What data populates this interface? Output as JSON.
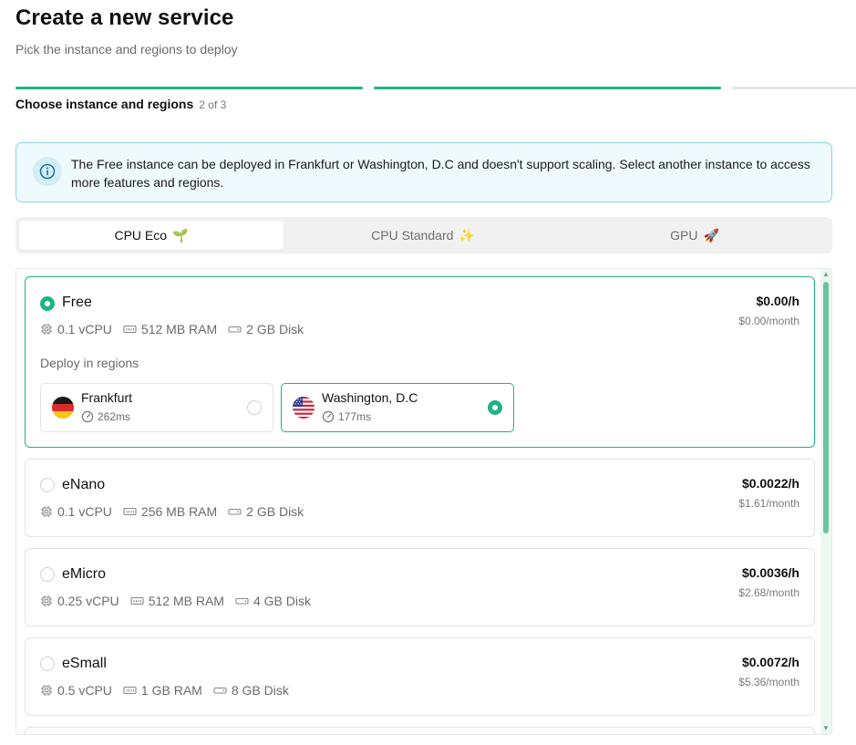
{
  "header": {
    "title": "Create a new service",
    "subtitle": "Pick the instance and regions to deploy"
  },
  "stepper": {
    "label": "Choose instance and regions",
    "count": "2 of 3",
    "accent_color": "#1fb385",
    "inactive_color": "#e4e4e4"
  },
  "info": {
    "icon": "info-icon",
    "text": "The Free instance can be deployed in Frankfurt or Washington, D.C and doesn't support scaling. Select another instance to access more features and regions."
  },
  "tabs": [
    {
      "label": "CPU Eco",
      "emoji": "🌱",
      "active": true
    },
    {
      "label": "CPU Standard",
      "emoji": "✨",
      "active": false
    },
    {
      "label": "GPU",
      "emoji": "🚀",
      "active": false
    }
  ],
  "instances": [
    {
      "name": "Free",
      "selected": true,
      "cpu": "0.1 vCPU",
      "ram": "512 MB RAM",
      "disk": "2 GB Disk",
      "price_hour": "$0.00/h",
      "price_month": "$0.00/month",
      "deploy_label": "Deploy in regions",
      "regions": [
        {
          "name": "Frankfurt",
          "latency": "262ms",
          "flag": "germany-flag-icon",
          "selected": false
        },
        {
          "name": "Washington, D.C",
          "latency": "177ms",
          "flag": "usa-flag-icon",
          "selected": true
        }
      ]
    },
    {
      "name": "eNano",
      "selected": false,
      "cpu": "0.1 vCPU",
      "ram": "256 MB RAM",
      "disk": "2 GB Disk",
      "price_hour": "$0.0022/h",
      "price_month": "$1.61/month"
    },
    {
      "name": "eMicro",
      "selected": false,
      "cpu": "0.25 vCPU",
      "ram": "512 MB RAM",
      "disk": "4 GB Disk",
      "price_hour": "$0.0036/h",
      "price_month": "$2.68/month"
    },
    {
      "name": "eSmall",
      "selected": false,
      "cpu": "0.5 vCPU",
      "ram": "1 GB RAM",
      "disk": "8 GB Disk",
      "price_hour": "$0.0072/h",
      "price_month": "$5.36/month"
    }
  ]
}
